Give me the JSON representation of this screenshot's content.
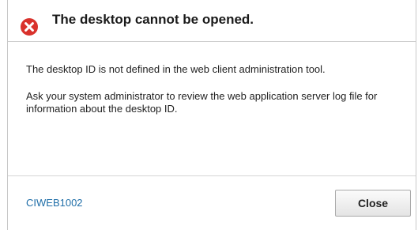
{
  "dialog": {
    "title": "The desktop cannot be opened.",
    "icon": "error-x-circle-icon",
    "paragraphs": [
      "The desktop ID is not defined in the web client administration tool.",
      "Ask your system administrator to review the web application server log file for information about the desktop ID."
    ],
    "message_code": "CIWEB1002",
    "close_label": "Close"
  },
  "colors": {
    "error_icon": "#d9322c",
    "link": "#1f6ea8",
    "divider": "#cfcfcf"
  }
}
